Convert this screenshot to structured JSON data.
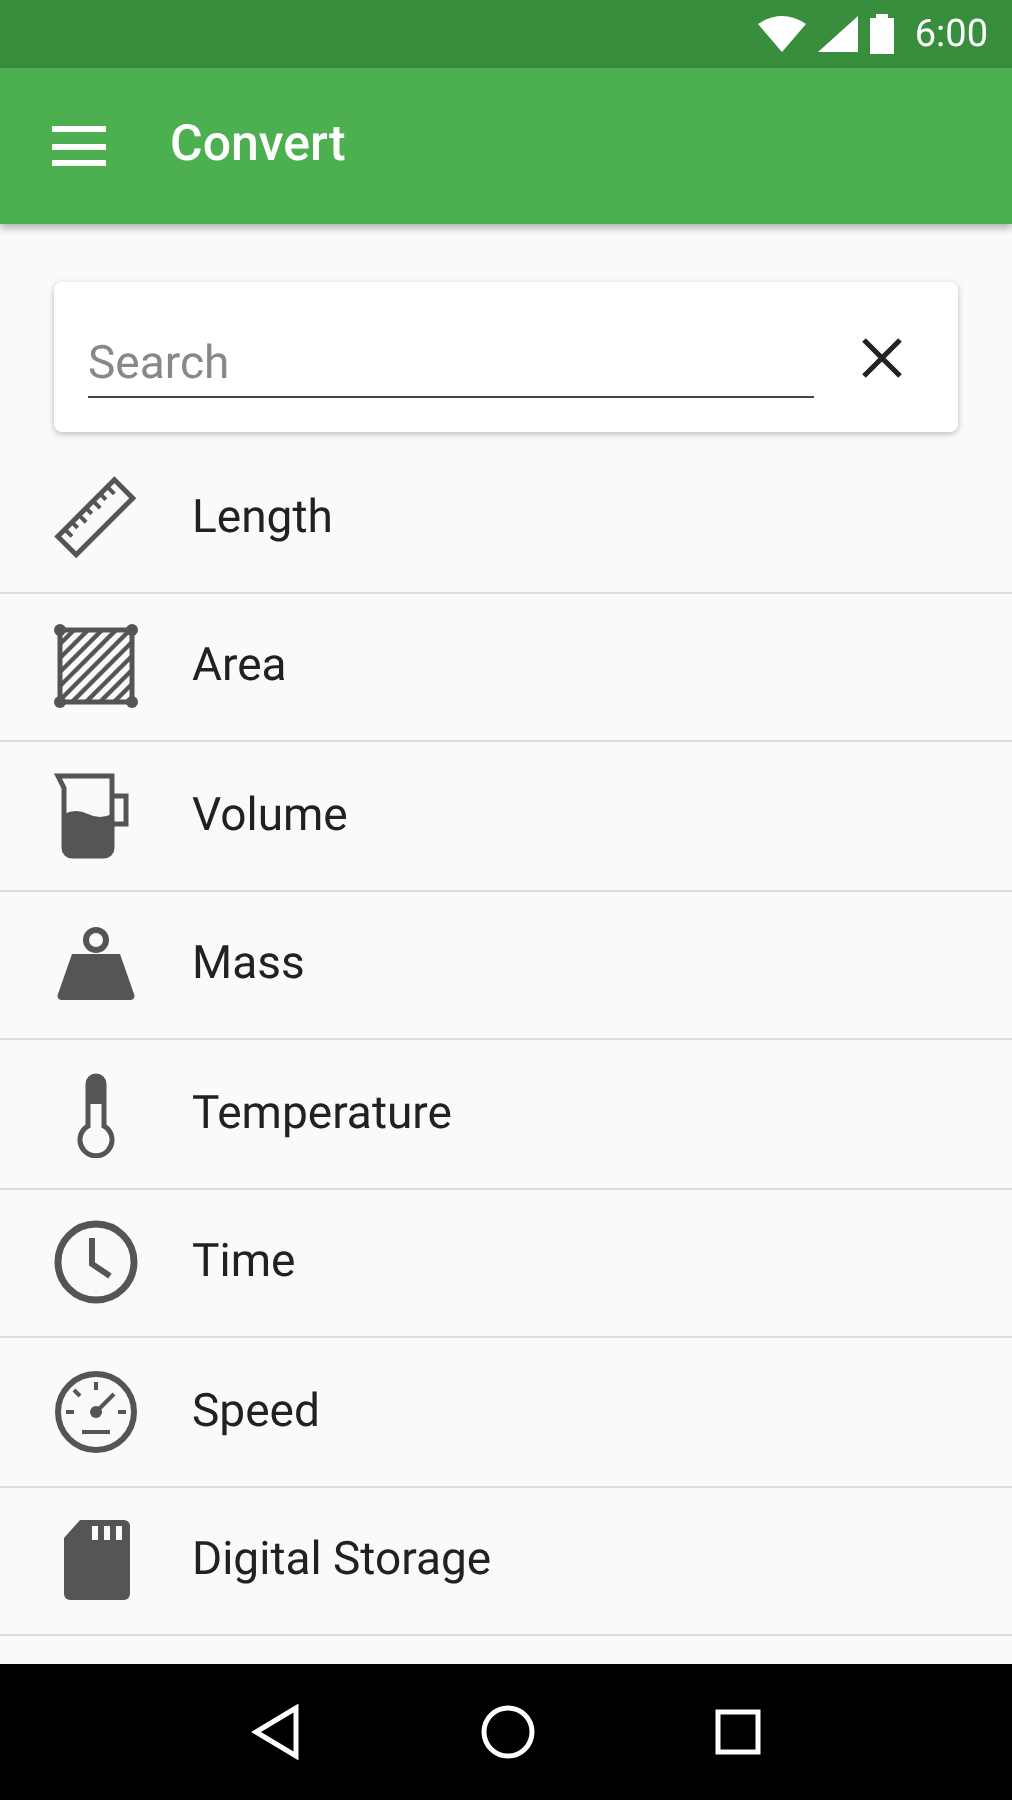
{
  "status_bar": {
    "time": "6:00"
  },
  "app_bar": {
    "title": "Convert"
  },
  "search": {
    "placeholder": "Search"
  },
  "categories": [
    {
      "label": "Length"
    },
    {
      "label": "Area"
    },
    {
      "label": "Volume"
    },
    {
      "label": "Mass"
    },
    {
      "label": "Temperature"
    },
    {
      "label": "Time"
    },
    {
      "label": "Speed"
    },
    {
      "label": "Digital Storage"
    }
  ]
}
